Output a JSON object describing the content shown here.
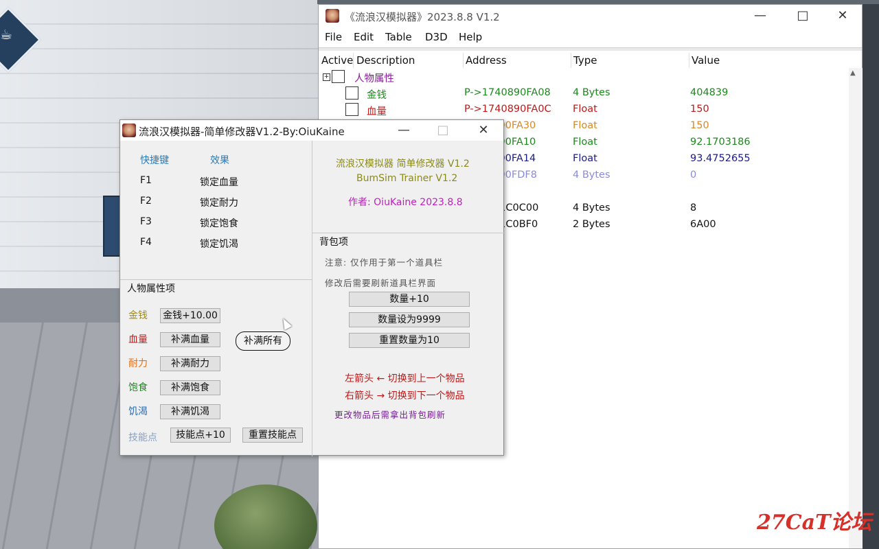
{
  "ce_window": {
    "title": "《流浪汉模拟器》2023.8.8 V1.2",
    "menu": [
      "File",
      "Edit",
      "Table",
      "D3D",
      "Help"
    ],
    "columns": [
      "Active",
      "Description",
      "Address",
      "Type",
      "Value"
    ],
    "group": "人物属性",
    "rows": [
      {
        "desc": "金钱",
        "addr": "P->1740890FA08",
        "type": "4 Bytes",
        "value": "404839",
        "color": "#1a8a1a"
      },
      {
        "desc": "血量",
        "addr": "P->1740890FA0C",
        "type": "Float",
        "value": "150",
        "color": "#c01818"
      },
      {
        "desc": "",
        "addr": "0890FA30",
        "type": "Float",
        "value": "150",
        "color": "#d98820"
      },
      {
        "desc": "",
        "addr": "0890FA10",
        "type": "Float",
        "value": "92.1703186",
        "color": "#1a8a1a"
      },
      {
        "desc": "",
        "addr": "0890FA14",
        "type": "Float",
        "value": "93.4752655",
        "color": "#1a1a8a"
      },
      {
        "desc": "",
        "addr": "0890FDF8",
        "type": "4 Bytes",
        "value": "0",
        "color": "#8a8ae0"
      },
      {
        "desc": "",
        "addr": "A51C0C00",
        "type": "4 Bytes",
        "value": "8",
        "color": "#111111"
      },
      {
        "desc": "",
        "addr": "A51C0BF0",
        "type": "2 Bytes",
        "value": "6A00",
        "color": "#111111"
      }
    ]
  },
  "trainer": {
    "title": "流浪汉模拟器-简单修改器V1.2-By:OiuKaine",
    "hotkey_header": "快捷键",
    "effect_header": "效果",
    "hotkeys": [
      {
        "key": "F1",
        "effect": "锁定血量"
      },
      {
        "key": "F2",
        "effect": "锁定耐力"
      },
      {
        "key": "F3",
        "effect": "锁定饱食"
      },
      {
        "key": "F4",
        "effect": "锁定饥渴"
      }
    ],
    "info_line1": "流浪汉模拟器 简单修改器 V1.2",
    "info_line2": "BumSim Trainer V1.2",
    "info_author": "作者: OiuKaine  2023.8.8",
    "attr_group": "人物属性项",
    "attrs": [
      {
        "label": "金钱",
        "button": "金钱+10.00",
        "color": "#9a8a20"
      },
      {
        "label": "血量",
        "button": "补满血量",
        "color": "#c01818"
      },
      {
        "label": "耐力",
        "button": "补满耐力",
        "color": "#e07020"
      },
      {
        "label": "饱食",
        "button": "补满饱食",
        "color": "#1a8a1a"
      },
      {
        "label": "饥渴",
        "button": "补满饥渴",
        "color": "#2a6ab0"
      }
    ],
    "fill_all": "补满所有",
    "skill_label": "技能点",
    "skill_button": "技能点+10",
    "skill_reset": "重置技能点",
    "bag_group": "背包项",
    "bag_note1": "注意: 仅作用于第一个道具栏",
    "bag_note2": "修改后需要刷新道具栏界面",
    "bag_buttons": [
      "数量+10",
      "数量设为9999",
      "重置数量为10"
    ],
    "arrow_left": "左箭头 ← 切换到上一个物品",
    "arrow_right": "右箭头 → 切换到下一个物品",
    "bag_refresh": "更改物品后需拿出背包刷新"
  },
  "watermark": "27CaT论坛",
  "colors": {
    "info_olive": "#8a8a1a",
    "author_magenta": "#c020c0",
    "arrow_red": "#c01818",
    "refresh_purple": "#7a1a9a",
    "header_blue": "#2a7ab8"
  }
}
